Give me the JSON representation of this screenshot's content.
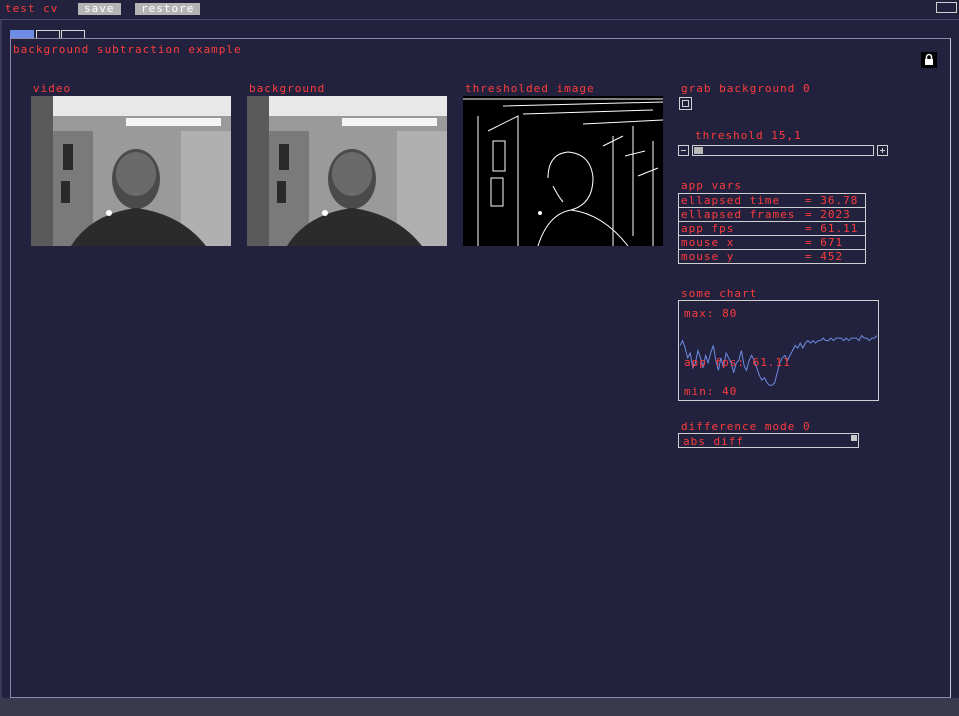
{
  "app": {
    "title": "test cv",
    "save_label": "save",
    "restore_label": "restore"
  },
  "panel": {
    "title": "background subtraction example"
  },
  "videos": [
    {
      "label": "video"
    },
    {
      "label": "background"
    },
    {
      "label": "thresholded image"
    }
  ],
  "controls": {
    "grab_label": "grab background 0",
    "threshold_label": "threshold 15,1",
    "threshold_fraction": 0.05,
    "app_vars_label": "app vars",
    "vars": [
      {
        "name": "ellapsed time",
        "value": "= 36.78"
      },
      {
        "name": "ellapsed frames",
        "value": "= 2023"
      },
      {
        "name": "app fps",
        "value": "= 61.11"
      },
      {
        "name": "mouse x",
        "value": "= 671"
      },
      {
        "name": "mouse y",
        "value": "= 452"
      }
    ],
    "chart_label": "some chart",
    "difference_label": "difference mode 0",
    "difference_value": "abs diff"
  },
  "chart_data": {
    "type": "line",
    "title": "some chart",
    "max_label": "max: 80",
    "min_label": "min: 40",
    "current_label": "app fps: 61.11",
    "ylim": [
      40,
      80
    ],
    "series": [
      {
        "values": [
          62,
          64,
          61,
          57,
          59,
          53,
          55,
          60,
          57,
          53,
          58,
          55,
          59,
          62,
          56,
          52,
          57,
          53,
          59,
          57,
          55,
          51,
          55,
          56,
          60,
          54,
          52,
          56,
          58,
          56,
          53,
          50,
          48,
          49,
          47,
          46,
          46,
          47,
          51,
          55,
          57,
          58,
          56,
          58,
          60,
          62,
          61,
          63,
          61,
          63,
          64,
          63,
          64,
          63,
          64,
          64,
          65,
          64,
          64,
          65,
          64,
          65,
          65,
          65,
          64,
          65,
          64,
          65,
          65,
          65,
          64,
          66,
          65,
          65,
          64,
          65,
          65,
          66
        ]
      }
    ]
  },
  "colors": {
    "background": "#22223f",
    "text": "#ff3b3b",
    "line": "#6d8ae0",
    "active_tab": "#6e8ee6"
  }
}
